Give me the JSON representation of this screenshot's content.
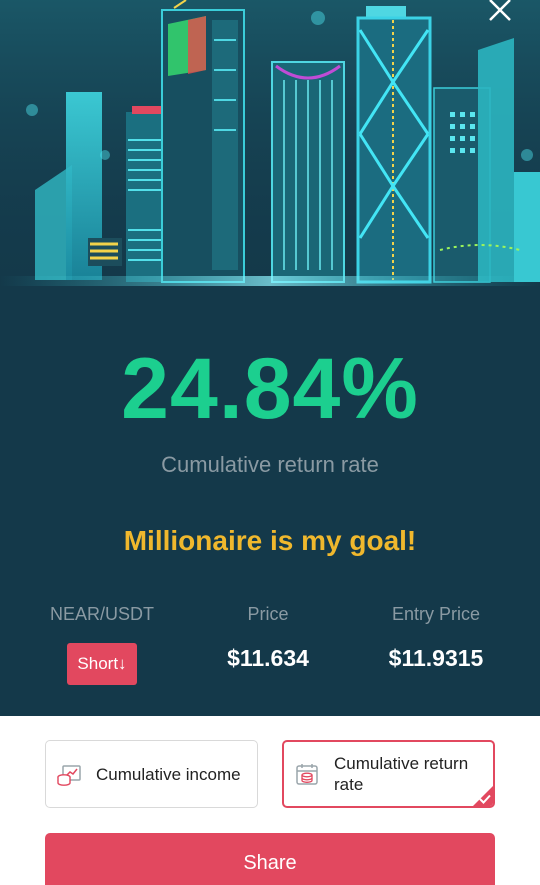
{
  "header": {
    "close_icon": "close-icon"
  },
  "hero": {
    "return_rate": "24.84%",
    "return_label": "Cumulative return rate",
    "slogan": "Millionaire is my goal!"
  },
  "stats": {
    "pair_label": "NEAR/USDT",
    "direction": "Short↓",
    "price_label": "Price",
    "price_value": "$11.634",
    "entry_label": "Entry Price",
    "entry_value": "$11.9315"
  },
  "options": [
    {
      "label": "Cumulative income",
      "icon": "income-chart-icon",
      "selected": false
    },
    {
      "label": "Cumulative return rate",
      "icon": "calendar-coins-icon",
      "selected": true
    }
  ],
  "share_button": "Share",
  "colors": {
    "card_bg": "#14394a",
    "accent_green": "#1ccf8f",
    "slogan_gold": "#f0b82d",
    "brand_red": "#e2485f"
  }
}
